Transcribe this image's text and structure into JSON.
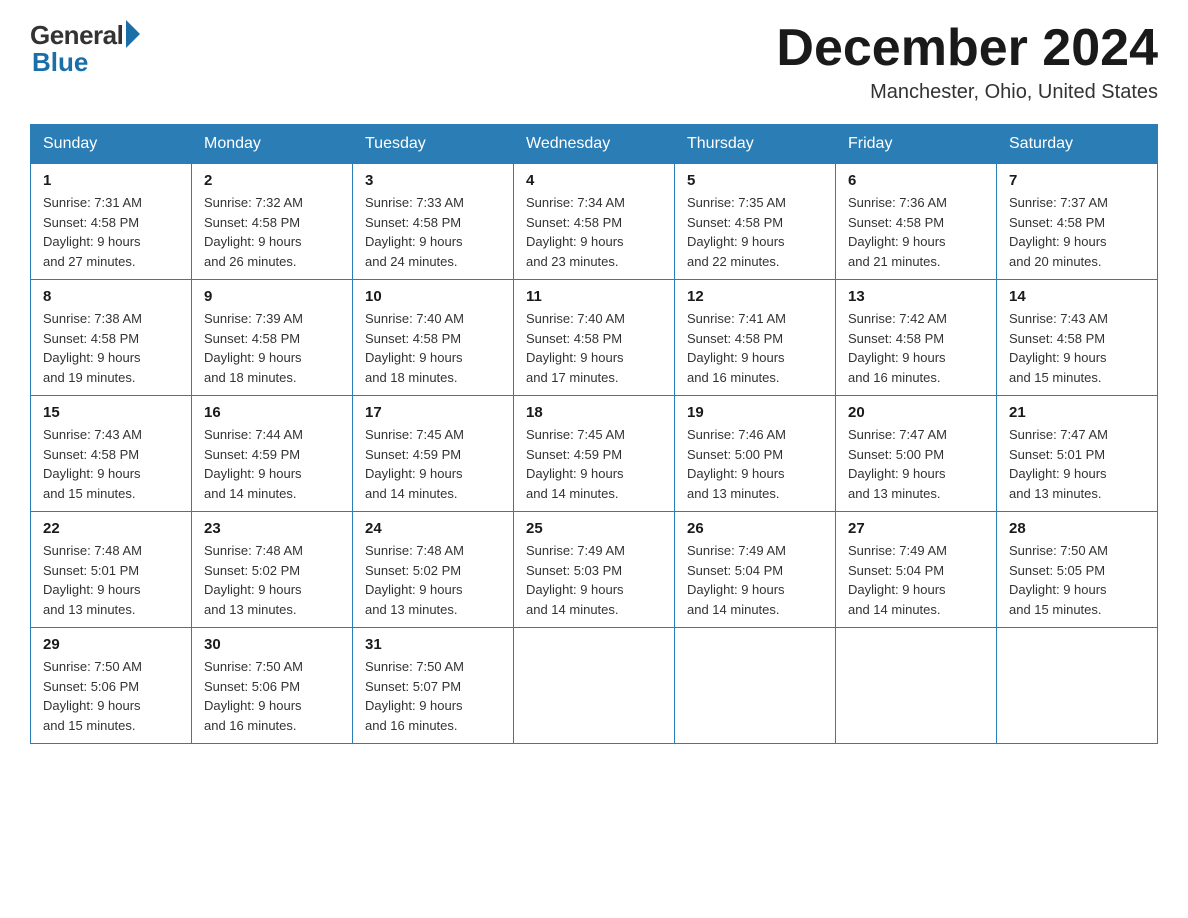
{
  "header": {
    "logo_general": "General",
    "logo_blue": "Blue",
    "month_title": "December 2024",
    "location": "Manchester, Ohio, United States"
  },
  "days_of_week": [
    "Sunday",
    "Monday",
    "Tuesday",
    "Wednesday",
    "Thursday",
    "Friday",
    "Saturday"
  ],
  "weeks": [
    [
      {
        "day": "1",
        "sunrise": "7:31 AM",
        "sunset": "4:58 PM",
        "daylight": "9 hours and 27 minutes."
      },
      {
        "day": "2",
        "sunrise": "7:32 AM",
        "sunset": "4:58 PM",
        "daylight": "9 hours and 26 minutes."
      },
      {
        "day": "3",
        "sunrise": "7:33 AM",
        "sunset": "4:58 PM",
        "daylight": "9 hours and 24 minutes."
      },
      {
        "day": "4",
        "sunrise": "7:34 AM",
        "sunset": "4:58 PM",
        "daylight": "9 hours and 23 minutes."
      },
      {
        "day": "5",
        "sunrise": "7:35 AM",
        "sunset": "4:58 PM",
        "daylight": "9 hours and 22 minutes."
      },
      {
        "day": "6",
        "sunrise": "7:36 AM",
        "sunset": "4:58 PM",
        "daylight": "9 hours and 21 minutes."
      },
      {
        "day": "7",
        "sunrise": "7:37 AM",
        "sunset": "4:58 PM",
        "daylight": "9 hours and 20 minutes."
      }
    ],
    [
      {
        "day": "8",
        "sunrise": "7:38 AM",
        "sunset": "4:58 PM",
        "daylight": "9 hours and 19 minutes."
      },
      {
        "day": "9",
        "sunrise": "7:39 AM",
        "sunset": "4:58 PM",
        "daylight": "9 hours and 18 minutes."
      },
      {
        "day": "10",
        "sunrise": "7:40 AM",
        "sunset": "4:58 PM",
        "daylight": "9 hours and 18 minutes."
      },
      {
        "day": "11",
        "sunrise": "7:40 AM",
        "sunset": "4:58 PM",
        "daylight": "9 hours and 17 minutes."
      },
      {
        "day": "12",
        "sunrise": "7:41 AM",
        "sunset": "4:58 PM",
        "daylight": "9 hours and 16 minutes."
      },
      {
        "day": "13",
        "sunrise": "7:42 AM",
        "sunset": "4:58 PM",
        "daylight": "9 hours and 16 minutes."
      },
      {
        "day": "14",
        "sunrise": "7:43 AM",
        "sunset": "4:58 PM",
        "daylight": "9 hours and 15 minutes."
      }
    ],
    [
      {
        "day": "15",
        "sunrise": "7:43 AM",
        "sunset": "4:58 PM",
        "daylight": "9 hours and 15 minutes."
      },
      {
        "day": "16",
        "sunrise": "7:44 AM",
        "sunset": "4:59 PM",
        "daylight": "9 hours and 14 minutes."
      },
      {
        "day": "17",
        "sunrise": "7:45 AM",
        "sunset": "4:59 PM",
        "daylight": "9 hours and 14 minutes."
      },
      {
        "day": "18",
        "sunrise": "7:45 AM",
        "sunset": "4:59 PM",
        "daylight": "9 hours and 14 minutes."
      },
      {
        "day": "19",
        "sunrise": "7:46 AM",
        "sunset": "5:00 PM",
        "daylight": "9 hours and 13 minutes."
      },
      {
        "day": "20",
        "sunrise": "7:47 AM",
        "sunset": "5:00 PM",
        "daylight": "9 hours and 13 minutes."
      },
      {
        "day": "21",
        "sunrise": "7:47 AM",
        "sunset": "5:01 PM",
        "daylight": "9 hours and 13 minutes."
      }
    ],
    [
      {
        "day": "22",
        "sunrise": "7:48 AM",
        "sunset": "5:01 PM",
        "daylight": "9 hours and 13 minutes."
      },
      {
        "day": "23",
        "sunrise": "7:48 AM",
        "sunset": "5:02 PM",
        "daylight": "9 hours and 13 minutes."
      },
      {
        "day": "24",
        "sunrise": "7:48 AM",
        "sunset": "5:02 PM",
        "daylight": "9 hours and 13 minutes."
      },
      {
        "day": "25",
        "sunrise": "7:49 AM",
        "sunset": "5:03 PM",
        "daylight": "9 hours and 14 minutes."
      },
      {
        "day": "26",
        "sunrise": "7:49 AM",
        "sunset": "5:04 PM",
        "daylight": "9 hours and 14 minutes."
      },
      {
        "day": "27",
        "sunrise": "7:49 AM",
        "sunset": "5:04 PM",
        "daylight": "9 hours and 14 minutes."
      },
      {
        "day": "28",
        "sunrise": "7:50 AM",
        "sunset": "5:05 PM",
        "daylight": "9 hours and 15 minutes."
      }
    ],
    [
      {
        "day": "29",
        "sunrise": "7:50 AM",
        "sunset": "5:06 PM",
        "daylight": "9 hours and 15 minutes."
      },
      {
        "day": "30",
        "sunrise": "7:50 AM",
        "sunset": "5:06 PM",
        "daylight": "9 hours and 16 minutes."
      },
      {
        "day": "31",
        "sunrise": "7:50 AM",
        "sunset": "5:07 PM",
        "daylight": "9 hours and 16 minutes."
      },
      null,
      null,
      null,
      null
    ]
  ],
  "labels": {
    "sunrise": "Sunrise:",
    "sunset": "Sunset:",
    "daylight": "Daylight:"
  }
}
